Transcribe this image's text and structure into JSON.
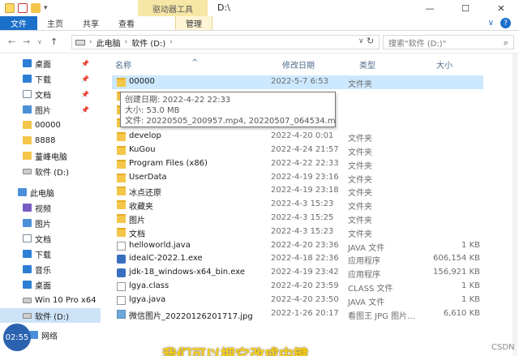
{
  "titlebar": {
    "context_tab": "驱动器工具",
    "path": "D:\\",
    "minimize": "—",
    "maximize": "☐",
    "close": "✕"
  },
  "ribbon": {
    "tabs": [
      "文件",
      "主页",
      "共享",
      "查看",
      "管理"
    ],
    "chevron": "∨",
    "help": "?"
  },
  "address": {
    "back": "←",
    "forward": "→",
    "recent": "∨",
    "up": "↑",
    "crumbs": [
      "此电脑",
      "软件 (D:)"
    ],
    "sep": "›",
    "dropdown": "∨",
    "refresh": "↻",
    "search_placeholder": "搜索\"软件 (D:)\"",
    "search_icon": "⌕"
  },
  "nav": {
    "items": [
      {
        "label": "桌面",
        "icon": "desktop",
        "color": "#2d7fd6",
        "pinned": true
      },
      {
        "label": "下载",
        "icon": "download",
        "color": "#2d7fd6",
        "pinned": true
      },
      {
        "label": "文档",
        "icon": "document",
        "color": "#7a8a9a",
        "pinned": true
      },
      {
        "label": "图片",
        "icon": "picture",
        "color": "#4a90d9",
        "pinned": true
      },
      {
        "label": "00000",
        "icon": "folder",
        "color": "#f4c64a",
        "pinned": false
      },
      {
        "label": "8888",
        "icon": "folder",
        "color": "#f4c64a",
        "pinned": false
      },
      {
        "label": "蕫峰电脑",
        "icon": "folder",
        "color": "#f4c64a",
        "pinned": false
      },
      {
        "label": "软件 (D:)",
        "icon": "drive",
        "color": "#888888",
        "pinned": false
      },
      {
        "label": "此电脑",
        "icon": "computer",
        "color": "#4a90d9",
        "pinned": false
      },
      {
        "label": "视频",
        "icon": "video",
        "color": "#7a5cc0",
        "pinned": false
      },
      {
        "label": "图片",
        "icon": "picture",
        "color": "#4a90d9",
        "pinned": false
      },
      {
        "label": "文档",
        "icon": "document",
        "color": "#7a8a9a",
        "pinned": false
      },
      {
        "label": "下载",
        "icon": "download",
        "color": "#2d7fd6",
        "pinned": false
      },
      {
        "label": "音乐",
        "icon": "music",
        "color": "#2d7fd6",
        "pinned": false
      },
      {
        "label": "桌面",
        "icon": "desktop",
        "color": "#2d7fd6",
        "pinned": false
      },
      {
        "label": "Win 10 Pro x64",
        "icon": "drive",
        "color": "#888888",
        "pinned": false
      },
      {
        "label": "软件 (D:)",
        "icon": "drive",
        "color": "#888888",
        "pinned": false
      },
      {
        "label": "网络",
        "icon": "network",
        "color": "#4a90d9",
        "pinned": false
      }
    ],
    "pin_glyph": "📌"
  },
  "columns": {
    "name": "名称",
    "date": "修改日期",
    "type": "类型",
    "size": "大小",
    "sort_glyph": "^"
  },
  "files": [
    {
      "name": "00000",
      "date": "2022-5-7 6:53",
      "type": "文件夹",
      "size": "",
      "kind": "folder",
      "selected": true
    },
    {
      "name": "",
      "date": "",
      "type": "",
      "size": "",
      "kind": "folder",
      "selected": false
    },
    {
      "name": "",
      "date": "",
      "type": "",
      "size": "",
      "kind": "folder",
      "selected": false
    },
    {
      "name": "",
      "date": "",
      "type": "",
      "size": "",
      "kind": "folder",
      "selected": false
    },
    {
      "name": "develop",
      "date": "2022-4-20 0:01",
      "type": "文件夹",
      "size": "",
      "kind": "folder",
      "selected": false
    },
    {
      "name": "KuGou",
      "date": "2022-4-24 21:57",
      "type": "文件夹",
      "size": "",
      "kind": "folder",
      "selected": false
    },
    {
      "name": "Program Files (x86)",
      "date": "2022-4-22 22:33",
      "type": "文件夹",
      "size": "",
      "kind": "folder",
      "selected": false
    },
    {
      "name": "UserData",
      "date": "2022-4-19 23:16",
      "type": "文件夹",
      "size": "",
      "kind": "folder",
      "selected": false
    },
    {
      "name": "冰点还原",
      "date": "2022-4-19 23:18",
      "type": "文件夹",
      "size": "",
      "kind": "folder",
      "selected": false
    },
    {
      "name": "收藏夹",
      "date": "2022-4-3 15:23",
      "type": "文件夹",
      "size": "",
      "kind": "folder",
      "selected": false
    },
    {
      "name": "图片",
      "date": "2022-4-3 15:25",
      "type": "文件夹",
      "size": "",
      "kind": "folder",
      "selected": false
    },
    {
      "name": "文档",
      "date": "2022-4-3 15:23",
      "type": "文件夹",
      "size": "",
      "kind": "folder",
      "selected": false
    },
    {
      "name": "helloworld.java",
      "date": "2022-4-20 23:36",
      "type": "JAVA 文件",
      "size": "1 KB",
      "kind": "doc",
      "selected": false
    },
    {
      "name": "idealC-2022.1.exe",
      "date": "2022-4-18 22:36",
      "type": "应用程序",
      "size": "606,154 KB",
      "kind": "exe",
      "selected": false
    },
    {
      "name": "jdk-18_windows-x64_bin.exe",
      "date": "2022-4-19 23:42",
      "type": "应用程序",
      "size": "156,921 KB",
      "kind": "exe",
      "selected": false
    },
    {
      "name": "lgya.class",
      "date": "2022-4-20 23:59",
      "type": "CLASS 文件",
      "size": "1 KB",
      "kind": "doc",
      "selected": false
    },
    {
      "name": "lgya.java",
      "date": "2022-4-20 23:50",
      "type": "JAVA 文件",
      "size": "1 KB",
      "kind": "doc",
      "selected": false
    },
    {
      "name": "微信图片_20220126201717.jpg",
      "date": "2022-1-26 20:17",
      "type": "看图王 JPG 图片...",
      "size": "6,610 KB",
      "kind": "img",
      "selected": false
    }
  ],
  "tooltip": {
    "created": "创建日期: 2022-4-22 22:33",
    "size": "大小: 53.0 MB",
    "files": "文件: 20220505_200957.mp4, 20220507_064534.mp4, ..."
  },
  "overlay": {
    "timer": "02:55",
    "subtitle": "我们可以把它改成中键",
    "watermark": "CSDN"
  }
}
